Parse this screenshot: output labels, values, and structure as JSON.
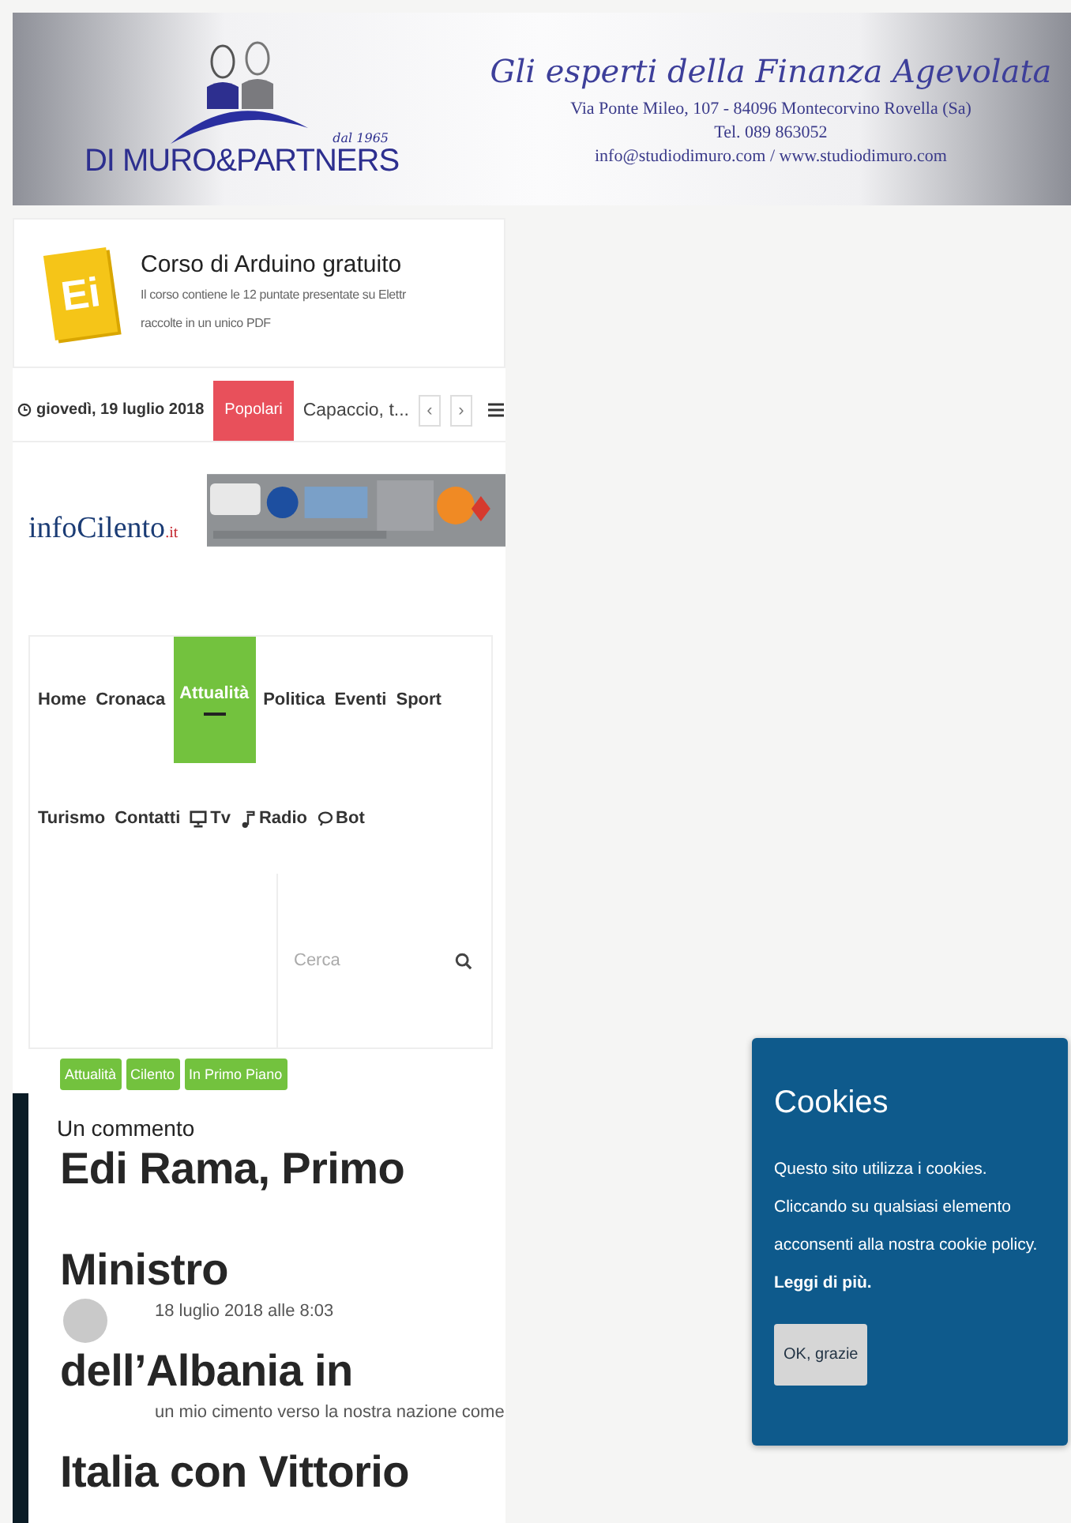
{
  "banner": {
    "brand": "DI MURO&PARTNERS",
    "since": "dal 1965",
    "slogan": "Gli esperti della Finanza Agevolata",
    "address": "Via Ponte Mileo, 107 - 84096 Montecorvino Rovella (Sa)",
    "phone": "Tel. 089 863052",
    "contacts": "info@studiodimuro.com / www.studiodimuro.com"
  },
  "promo": {
    "logo": "Ei",
    "title": "Corso di Arduino gratuito",
    "lines": [
      "Il corso contiene le 12 puntate presentate su Elettr",
      "raccolte in un unico PDF"
    ]
  },
  "top_bar": {
    "date": "giovedì, 19 luglio 2018",
    "label": "Popolari",
    "headline": "Capaccio, t...",
    "prev": "‹",
    "next": "›"
  },
  "site_logo": {
    "name": "infoCilento",
    "suffix": ".it"
  },
  "nav_rows": [
    [
      {
        "label": "Home",
        "kind": "link",
        "selected": false
      },
      {
        "label": "Cronaca",
        "kind": "link",
        "selected": false
      },
      {
        "label": "Attualità",
        "kind": "link",
        "selected": true
      },
      {
        "label": "Politica",
        "kind": "link",
        "selected": false
      },
      {
        "label": "Eventi",
        "kind": "link",
        "selected": false
      },
      {
        "label": "Sport",
        "kind": "link",
        "selected": false
      }
    ],
    [
      {
        "label": "Turismo",
        "kind": "link",
        "selected": false
      },
      {
        "label": "Contatti",
        "kind": "link",
        "selected": false
      },
      {
        "label": "Tv",
        "kind": "tv",
        "selected": false
      },
      {
        "label": "Radio",
        "kind": "radio",
        "selected": false
      },
      {
        "label": "Bot",
        "kind": "bot",
        "selected": false
      }
    ]
  ],
  "search": {
    "placeholder": "Cerca"
  },
  "tags": [
    "Attualità",
    "Cilento",
    "In Primo Piano"
  ],
  "comments": {
    "heading": "Un commento",
    "date": "18 luglio 2018 alle 8:03",
    "excerpt": "un mio cimento verso la nostra nazione come"
  },
  "article": {
    "title_lines": [
      "Edi Rama, Primo",
      "Ministro",
      "dell’Albania in",
      "Italia con Vittorio"
    ]
  },
  "cookie_notice": {
    "title": "Cookies",
    "text": "Questo sito utilizza i cookies. Cliccando su qualsiasi elemento acconsenti alla nostra cookie policy.",
    "link": "Leggi di più.",
    "button": "OK, grazie"
  }
}
